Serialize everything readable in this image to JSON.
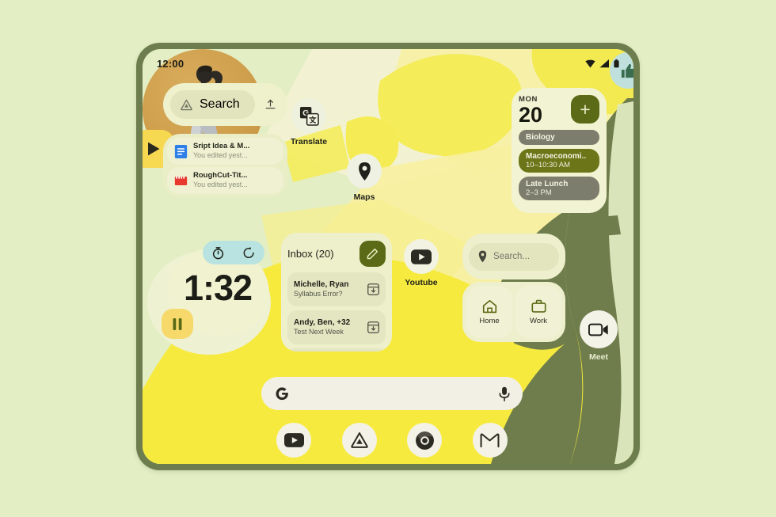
{
  "wallpaper": {
    "background_color": "#e4eec4",
    "frame_color": "#6e7d4e",
    "yellow": "#f5e948",
    "bright_yellow": "#f7ea3e",
    "pale_yellow": "#f1f0c2",
    "olive_shape": "#6f7d4c",
    "cream": "#f4f3d8"
  },
  "status_bar": {
    "time": "12:00",
    "icons": [
      "wifi-icon",
      "signal-icon",
      "battery-icon"
    ]
  },
  "drive_search_widget": {
    "icon": "drive-icon",
    "placeholder": "Search",
    "upload_icon": "upload-icon"
  },
  "drive_files_widget": {
    "files": [
      {
        "icon": "google-docs-icon",
        "title": "Sript Idea & M...",
        "subtitle": "You edited yest..."
      },
      {
        "icon": "video-clip-icon",
        "title": "RoughCut-Tit...",
        "subtitle": "You edited yest..."
      }
    ]
  },
  "app_icons": [
    {
      "name": "translate",
      "label": "Translate",
      "icon": "translate-icon"
    },
    {
      "name": "maps",
      "label": "Maps",
      "icon": "map-pin-icon"
    },
    {
      "name": "youtube",
      "label": "Youtube",
      "icon": "youtube-icon"
    },
    {
      "name": "meet",
      "label": "Meet",
      "icon": "video-camera-icon"
    }
  ],
  "timer_widget": {
    "value": "1:32",
    "stopwatch_icon": "stopwatch-icon",
    "reset_icon": "reset-icon",
    "pause_icon": "pause-icon",
    "accent": "#f6d96a",
    "controls_bg": "#b9e3e0"
  },
  "gmail_widget": {
    "title": "Inbox (20)",
    "compose_icon": "pencil-icon",
    "compose_bg": "#5b6a16",
    "rows": [
      {
        "from": "Michelle, Ryan",
        "subject": "Syllabus Error?",
        "action_icon": "archive-icon"
      },
      {
        "from": "Andy, Ben, +32",
        "subject": "Test Next Week",
        "action_icon": "archive-icon"
      }
    ]
  },
  "calendar_widget": {
    "day_of_week": "MON",
    "day_number": "20",
    "add_label": "+",
    "add_bg": "#5b6a16",
    "events": [
      {
        "title": "Biology",
        "time": "",
        "color": "#7d7d6d"
      },
      {
        "title": "Macroeconomi..",
        "time": "10–10:30 AM",
        "color": "#6d7519"
      },
      {
        "title": "Late Lunch",
        "time": "2–3 PM",
        "color": "#7d7d6d"
      }
    ]
  },
  "maps_widget": {
    "search_placeholder": "Search...",
    "pin_icon": "map-pin-icon",
    "shortcuts": [
      {
        "label": "Home",
        "icon": "home-icon"
      },
      {
        "label": "Work",
        "icon": "briefcase-icon"
      }
    ]
  },
  "photo_widget": {
    "image_alt": "dancing-person-photo",
    "thumbs_up_icon": "thumbs-up-icon",
    "thumb_bg": "#bfe0dc",
    "play_icon": "play-icon",
    "play_bg": "#f7d851"
  },
  "google_search_bar": {
    "logo": "google-g-icon",
    "mic_icon": "microphone-icon",
    "value": ""
  },
  "dock": {
    "items": [
      {
        "name": "youtube",
        "icon": "youtube-icon"
      },
      {
        "name": "drive",
        "icon": "drive-icon"
      },
      {
        "name": "chrome",
        "icon": "chrome-icon"
      },
      {
        "name": "gmail",
        "icon": "gmail-icon"
      }
    ]
  }
}
